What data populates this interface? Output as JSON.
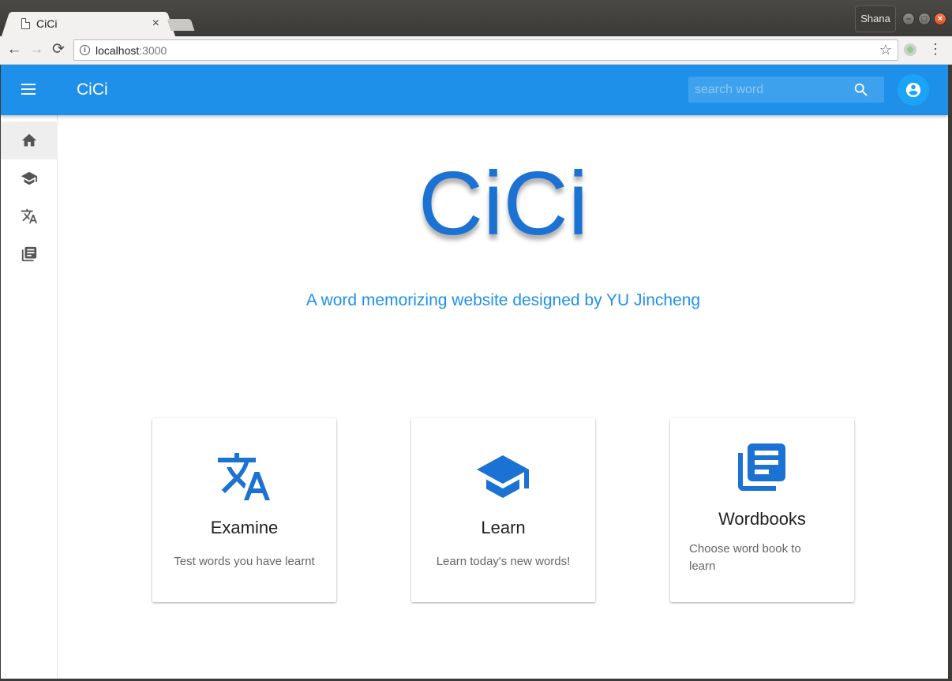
{
  "browser": {
    "tab_title": "CiCi",
    "tab_close": "×",
    "profile_name": "Shana",
    "url_host": "localhost",
    "url_port": ":3000"
  },
  "app": {
    "brand": "CiCi",
    "search_placeholder": "search word",
    "accent_color": "#1e90ea"
  },
  "sidebar": {
    "items": [
      {
        "name": "home",
        "icon": "home-icon",
        "active": true
      },
      {
        "name": "learn",
        "icon": "school-icon",
        "active": false
      },
      {
        "name": "examine",
        "icon": "translate-icon",
        "active": false
      },
      {
        "name": "wordbooks",
        "icon": "library-books-icon",
        "active": false
      }
    ]
  },
  "hero": {
    "title": "CiCi",
    "subtitle": "A word memorizing website designed by YU Jincheng"
  },
  "cards": [
    {
      "title": "Examine",
      "description": "Test words you have learnt",
      "icon": "translate-icon"
    },
    {
      "title": "Learn",
      "description": "Learn today's new words!",
      "icon": "school-icon"
    },
    {
      "title": "Wordbooks",
      "description": "Choose word book to learn",
      "icon": "library-books-icon"
    }
  ]
}
